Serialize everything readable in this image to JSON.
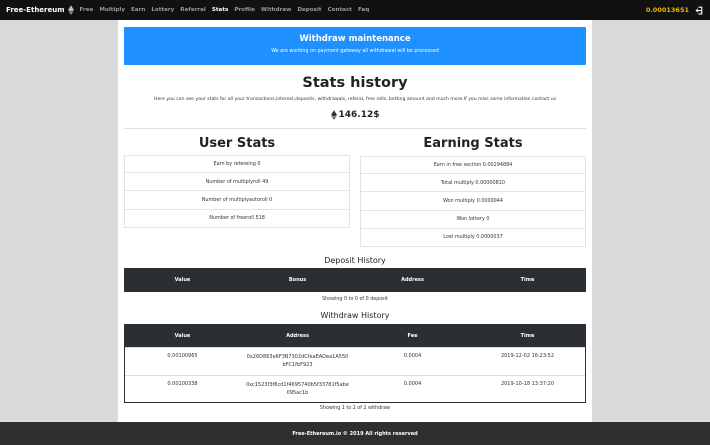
{
  "nav": {
    "brand": "Free-Ethereum",
    "links": [
      "Free",
      "Multiply",
      "Earn",
      "Lottery",
      "Referral",
      "Stats",
      "Profile",
      "Withdraw",
      "Deposit",
      "Contact",
      "Faq"
    ],
    "active": "Stats",
    "balance": "0.00013651",
    "logout_icon": "logout-icon"
  },
  "alert": {
    "title": "Withdraw maintenance",
    "text": "We are working on payment gateway all withdrawal will be processed"
  },
  "stats": {
    "title": "Stats history",
    "subtitle": "Here you can see your stats for all your transactions,interest,deposits, withdrawals, referal, free rolls, betting amount and much more.If you miss some information contact us",
    "total": "146.12$"
  },
  "user_stats": {
    "title": "User Stats",
    "items": [
      "Earn by refereing 0",
      "Number of multiplyroll 49",
      "Number of multiplyautoroll 0",
      "Number of freeroll 518"
    ]
  },
  "earning_stats": {
    "title": "Earning Stats",
    "items": [
      "Earn in free section 0.00294884",
      "Total multiply 0.00000810",
      "Won multiply 0.0000044",
      "Won lottery 0",
      "Lost multiply 0.0000037"
    ]
  },
  "deposit": {
    "title": "Deposit History",
    "headers": [
      "Value",
      "Bonus",
      "Address",
      "Time"
    ],
    "info": "Showing 0 to 0 of 0 deposit"
  },
  "withdraw": {
    "title": "Withdraw History",
    "headers": [
      "Value",
      "Address",
      "Fee",
      "Time"
    ],
    "rows": [
      {
        "value": "0.00100965",
        "address": "0x26D863e6F3B7302dCfeaEADea1A550 bFC1fbF923",
        "fee": "0.0004",
        "time": "2019-12-02 16:23:52"
      },
      {
        "value": "0.00100338",
        "address": "0xc1523f3f8cd1f4695740b5f33781f5abe 095ac1b",
        "fee": "0.0004",
        "time": "2019-10-18 13:37:20"
      }
    ],
    "info": "Showing 1 to 2 of 2 withdraw"
  },
  "footer": "Free-Ethereum.io © 2019 All rights reserved"
}
